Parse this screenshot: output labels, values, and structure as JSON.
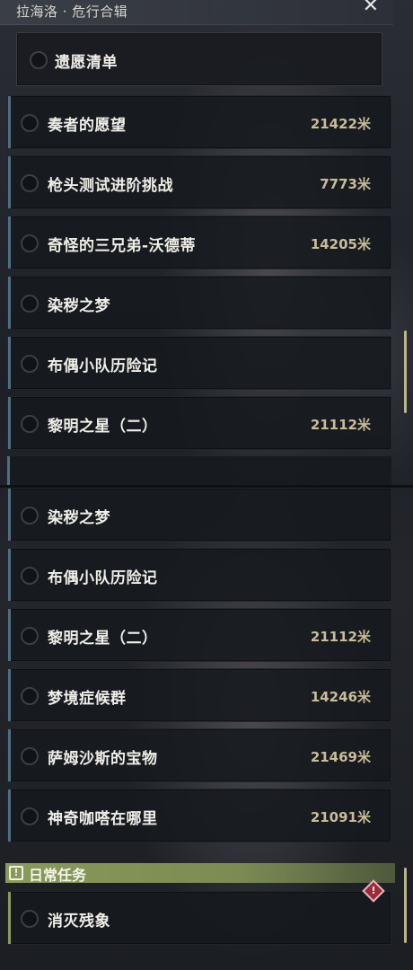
{
  "header": {
    "title": "拉海洛 · 危行合辑",
    "close_label": "✕"
  },
  "wishlist": {
    "label": "遗愿清单"
  },
  "top_quests": [
    {
      "name": "奏者的愿望",
      "distance": "21422米"
    },
    {
      "name": "枪头测试进阶挑战",
      "distance": "7773米"
    },
    {
      "name": "奇怪的三兄弟-沃德蒂",
      "distance": "14205米"
    },
    {
      "name": "染秽之梦",
      "distance": ""
    },
    {
      "name": "布偶小队历险记",
      "distance": ""
    },
    {
      "name": "黎明之星（二）",
      "distance": "21112米"
    }
  ],
  "bottom_quests": [
    {
      "name": "染秽之梦",
      "distance": ""
    },
    {
      "name": "布偶小队历险记",
      "distance": ""
    },
    {
      "name": "黎明之星（二）",
      "distance": "21112米"
    },
    {
      "name": "梦境症候群",
      "distance": "14246米"
    },
    {
      "name": "萨姆沙斯的宝物",
      "distance": "21469米"
    },
    {
      "name": "神奇咖嗒在哪里",
      "distance": "21091米"
    }
  ],
  "daily": {
    "section_title": "日常任务",
    "section_icon": "!",
    "quests": [
      {
        "name": "消灭残象",
        "alert": "!"
      }
    ]
  },
  "colors": {
    "accent_blue": "#4f6e83",
    "distance_gold": "#c9bd98",
    "daily_green": "#8a9a5a",
    "alert_red": "#9b2a3a"
  }
}
